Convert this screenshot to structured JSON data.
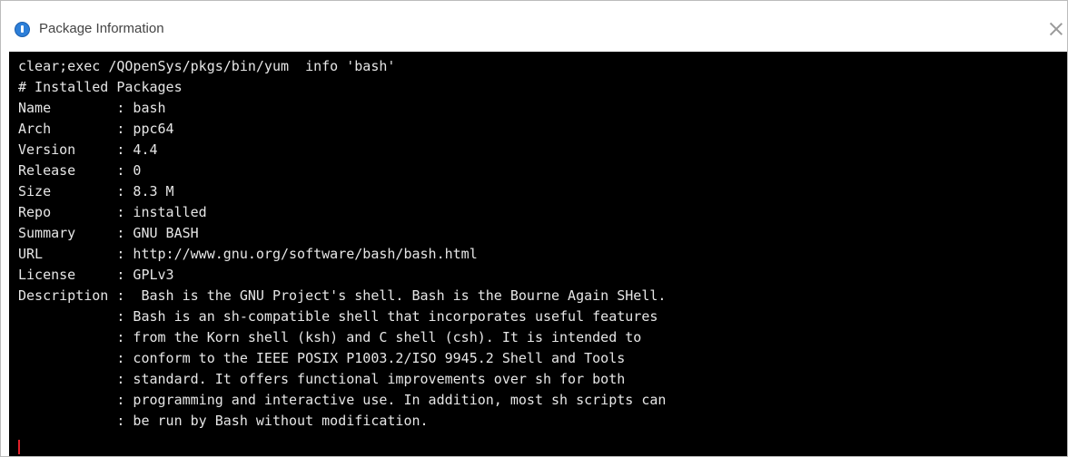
{
  "window": {
    "title": "Package Information",
    "close_symbol": "close-icon"
  },
  "terminal": {
    "lines": [
      "clear;exec /QOpenSys/pkgs/bin/yum  info 'bash'",
      "# Installed Packages",
      "Name        : bash",
      "Arch        : ppc64",
      "Version     : 4.4",
      "Release     : 0",
      "Size        : 8.3 M",
      "Repo        : installed",
      "Summary     : GNU BASH",
      "URL         : http://www.gnu.org/software/bash/bash.html",
      "License     : GPLv3",
      "Description :  Bash is the GNU Project's shell. Bash is the Bourne Again SHell.",
      "            : Bash is an sh-compatible shell that incorporates useful features",
      "            : from the Korn shell (ksh) and C shell (csh). It is intended to",
      "            : conform to the IEEE POSIX P1003.2/ISO 9945.2 Shell and Tools",
      "            : standard. It offers functional improvements over sh for both",
      "            : programming and interactive use. In addition, most sh scripts can",
      "            : be run by Bash without modification."
    ],
    "background_color": "#000000",
    "text_color": "#e6e6e6",
    "cursor_color": "#e0202a"
  }
}
